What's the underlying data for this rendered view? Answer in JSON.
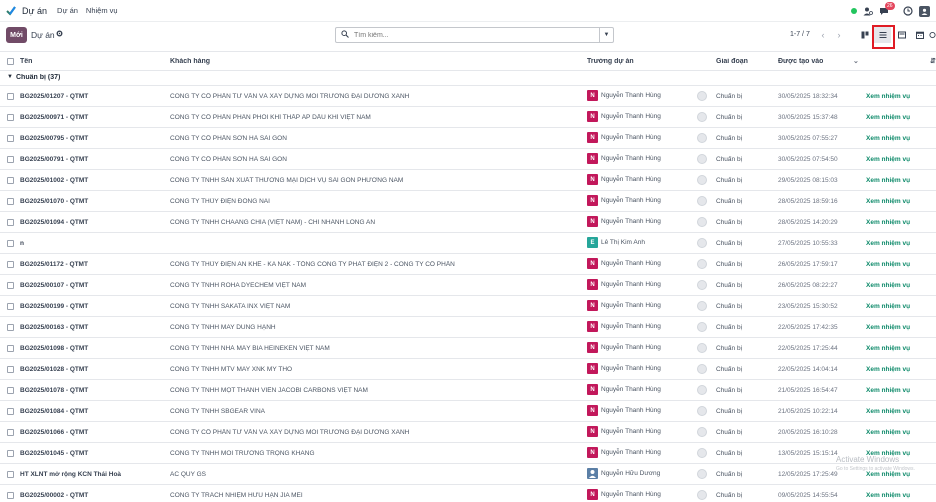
{
  "navbar": {
    "app_name": "Dự án",
    "menus": [
      "Dự án",
      "Nhiệm vụ"
    ],
    "message_count": "26"
  },
  "control": {
    "new_label": "Mới",
    "breadcrumb": "Dự án",
    "search_placeholder": "Tìm kiếm...",
    "pager": "1-7 / 7"
  },
  "table": {
    "headers": {
      "name": "Tên",
      "customer": "Khách hàng",
      "manager": "Trưởng dự án",
      "stage": "Giai đoạn",
      "created": "Được tạo vào"
    },
    "group_label": "Chuẩn bị (37)",
    "rows": [
      {
        "name": "BG2025/01207 - QTMT",
        "customer": "CÔNG TY CỔ PHẦN TƯ VẤN VÀ XÂY DỰNG MÔI TRƯỜNG ĐẠI DƯƠNG XANH",
        "avatar": "N",
        "avatar_color": "#c2185b",
        "manager": "Nguyễn Thanh Hùng",
        "stage": "Chuẩn bị",
        "created": "30/05/2025 18:32:34",
        "action": "Xem nhiệm vụ"
      },
      {
        "name": "BG2025/00971 - QTMT",
        "customer": "CÔNG TY CỔ PHẦN PHÂN PHỐI KHÍ THẤP ÁP DẦU KHÍ VIỆT NAM",
        "avatar": "N",
        "avatar_color": "#c2185b",
        "manager": "Nguyễn Thanh Hùng",
        "stage": "Chuẩn bị",
        "created": "30/05/2025 15:37:48",
        "action": "Xem nhiệm vụ"
      },
      {
        "name": "BG2025/00795 - QTMT",
        "customer": "CÔNG TY CỔ PHẦN SƠN HÀ SÀI GÒN",
        "avatar": "N",
        "avatar_color": "#c2185b",
        "manager": "Nguyễn Thanh Hùng",
        "stage": "Chuẩn bị",
        "created": "30/05/2025 07:55:27",
        "action": "Xem nhiệm vụ"
      },
      {
        "name": "BG2025/00791 - QTMT",
        "customer": "CÔNG TY CỔ PHẦN SƠN HÀ SÀI GÒN",
        "avatar": "N",
        "avatar_color": "#c2185b",
        "manager": "Nguyễn Thanh Hùng",
        "stage": "Chuẩn bị",
        "created": "30/05/2025 07:54:50",
        "action": "Xem nhiệm vụ"
      },
      {
        "name": "BG2025/01002 - QTMT",
        "customer": "CÔNG TY TNHH SẢN XUẤT THƯƠNG MẠI DỊCH VỤ SÀI GÒN PHƯƠNG NAM",
        "avatar": "N",
        "avatar_color": "#c2185b",
        "manager": "Nguyễn Thanh Hùng",
        "stage": "Chuẩn bị",
        "created": "29/05/2025 08:15:03",
        "action": "Xem nhiệm vụ"
      },
      {
        "name": "BG2025/01070 - QTMT",
        "customer": "CÔNG TY THỦY ĐIỆN ĐỒNG NAI",
        "avatar": "N",
        "avatar_color": "#c2185b",
        "manager": "Nguyễn Thanh Hùng",
        "stage": "Chuẩn bị",
        "created": "28/05/2025 18:59:16",
        "action": "Xem nhiệm vụ"
      },
      {
        "name": "BG2025/01094 - QTMT",
        "customer": "CÔNG TY TNHH CHAANG CHIA (VIỆT NAM) - CHI NHÁNH LONG AN",
        "avatar": "N",
        "avatar_color": "#c2185b",
        "manager": "Nguyễn Thanh Hùng",
        "stage": "Chuẩn bị",
        "created": "28/05/2025 14:20:29",
        "action": "Xem nhiệm vụ"
      },
      {
        "name": "n",
        "customer": "",
        "avatar": "E",
        "avatar_color": "#26a69a",
        "manager": "Lê Thị Kim Anh",
        "stage": "Chuẩn bị",
        "created": "27/05/2025 10:55:33",
        "action": "Xem nhiệm vụ"
      },
      {
        "name": "BG2025/01172 - QTMT",
        "customer": "CÔNG TY THỦY ĐIỆN AN KHÊ - KA NAK - TỔNG CÔNG TY PHÁT ĐIỆN 2 - CÔNG TY CỔ PHẦN",
        "avatar": "N",
        "avatar_color": "#c2185b",
        "manager": "Nguyễn Thanh Hùng",
        "stage": "Chuẩn bị",
        "created": "26/05/2025 17:59:17",
        "action": "Xem nhiệm vụ"
      },
      {
        "name": "BG2025/00107 - QTMT",
        "customer": "CÔNG TY TNHH ROHA DYECHEM VIỆT NAM",
        "avatar": "N",
        "avatar_color": "#c2185b",
        "manager": "Nguyễn Thanh Hùng",
        "stage": "Chuẩn bị",
        "created": "26/05/2025 08:22:27",
        "action": "Xem nhiệm vụ"
      },
      {
        "name": "BG2025/00199 - QTMT",
        "customer": "CÔNG TY TNHH SAKATA INX VIỆT NAM",
        "avatar": "N",
        "avatar_color": "#c2185b",
        "manager": "Nguyễn Thanh Hùng",
        "stage": "Chuẩn bị",
        "created": "23/05/2025 15:30:52",
        "action": "Xem nhiệm vụ"
      },
      {
        "name": "BG2025/00163 - QTMT",
        "customer": "CÔNG TY TNHH MAY DUNG HẠNH",
        "avatar": "N",
        "avatar_color": "#c2185b",
        "manager": "Nguyễn Thanh Hùng",
        "stage": "Chuẩn bị",
        "created": "22/05/2025 17:42:35",
        "action": "Xem nhiệm vụ"
      },
      {
        "name": "BG2025/01098 - QTMT",
        "customer": "CÔNG TY TNHH NHÀ MÁY BIA HEINEKEN VIỆT NAM",
        "avatar": "N",
        "avatar_color": "#c2185b",
        "manager": "Nguyễn Thanh Hùng",
        "stage": "Chuẩn bị",
        "created": "22/05/2025 17:25:44",
        "action": "Xem nhiệm vụ"
      },
      {
        "name": "BG2025/01028 - QTMT",
        "customer": "CÔNG TY TNHH MTV MAY XNK MỸ THO",
        "avatar": "N",
        "avatar_color": "#c2185b",
        "manager": "Nguyễn Thanh Hùng",
        "stage": "Chuẩn bị",
        "created": "22/05/2025 14:04:14",
        "action": "Xem nhiệm vụ"
      },
      {
        "name": "BG2025/01078 - QTMT",
        "customer": "CÔNG TY TNHH MỘT THÀNH VIÊN JACOBI CARBONS VIỆT NAM",
        "avatar": "N",
        "avatar_color": "#c2185b",
        "manager": "Nguyễn Thanh Hùng",
        "stage": "Chuẩn bị",
        "created": "21/05/2025 16:54:47",
        "action": "Xem nhiệm vụ"
      },
      {
        "name": "BG2025/01084 - QTMT",
        "customer": "CÔNG TY TNHH SBGEAR VINA",
        "avatar": "N",
        "avatar_color": "#c2185b",
        "manager": "Nguyễn Thanh Hùng",
        "stage": "Chuẩn bị",
        "created": "21/05/2025 10:22:14",
        "action": "Xem nhiệm vụ"
      },
      {
        "name": "BG2025/01066 - QTMT",
        "customer": "CÔNG TY CỔ PHẦN TƯ VẤN VÀ XÂY DỰNG MÔI TRƯỜNG ĐẠI DƯƠNG XANH",
        "avatar": "N",
        "avatar_color": "#c2185b",
        "manager": "Nguyễn Thanh Hùng",
        "stage": "Chuẩn bị",
        "created": "20/05/2025 16:10:28",
        "action": "Xem nhiệm vụ"
      },
      {
        "name": "BG2025/01045 - QTMT",
        "customer": "CÔNG TY TNHH MÔI TRƯỜNG TRỌNG KHANG",
        "avatar": "N",
        "avatar_color": "#c2185b",
        "manager": "Nguyễn Thanh Hùng",
        "stage": "Chuẩn bị",
        "created": "13/05/2025 15:15:14",
        "action": "Xem nhiệm vụ"
      },
      {
        "name": "HT XLNT mở rộng KCN Thái Hoà",
        "customer": "AC QUY GS",
        "avatar": "",
        "avatar_color": "#5b7fa6",
        "manager": "Nguyễn Hữu Dương",
        "stage": "Chuẩn bị",
        "created": "12/05/2025 17:25:49",
        "action": "Xem nhiệm vụ"
      },
      {
        "name": "BG2025/00002 - QTMT",
        "customer": "CÔNG TY TRÁCH NHIỆM HỮU HẠN JIA MEI",
        "avatar": "N",
        "avatar_color": "#c2185b",
        "manager": "Nguyễn Thanh Hùng",
        "stage": "Chuẩn bị",
        "created": "09/05/2025 14:55:54",
        "action": "Xem nhiệm vụ"
      }
    ]
  },
  "watermark": {
    "title": "Activate Windows",
    "subtitle": "Go to Settings to activate Windows."
  },
  "colors": {
    "brand": "#714b67",
    "link": "#0e8a6a",
    "highlight": "#e01b24"
  }
}
